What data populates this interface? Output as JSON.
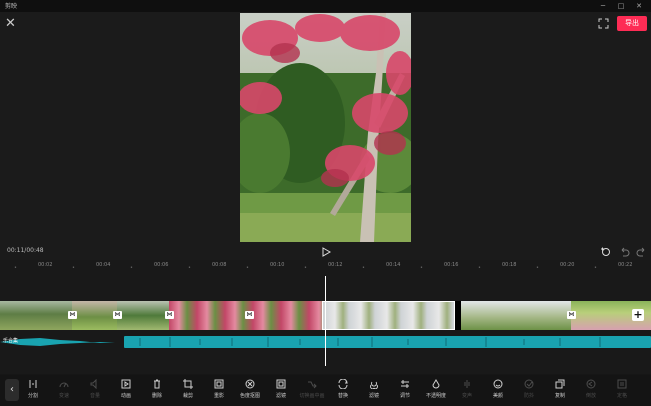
{
  "window": {
    "title": "剪映",
    "minimize": "─",
    "maximize": "□",
    "close": "✕"
  },
  "preview": {
    "close_icon": "✕",
    "export_label": "导出"
  },
  "player": {
    "timecode": "00:11/00:48"
  },
  "ruler": {
    "labels": [
      "00:02",
      "00:04",
      "00:06",
      "00:08",
      "00:10",
      "00:12",
      "00:14",
      "00:16",
      "00:18",
      "00:20",
      "00:22"
    ]
  },
  "timeline": {
    "audio_label": "乐合集",
    "add_icon": "+",
    "transition_icon": "⋈"
  },
  "toolbar": {
    "back_icon": "‹",
    "tools": [
      {
        "label": "分割",
        "icon": "split-icon",
        "enabled": true
      },
      {
        "label": "变速",
        "icon": "speed-icon",
        "enabled": false
      },
      {
        "label": "音量",
        "icon": "volume-icon",
        "enabled": false
      },
      {
        "label": "动画",
        "icon": "animation-icon",
        "enabled": true
      },
      {
        "label": "删除",
        "icon": "delete-icon",
        "enabled": true
      },
      {
        "label": "裁剪",
        "icon": "crop-icon",
        "enabled": true
      },
      {
        "label": "重影",
        "icon": "ghost-icon",
        "enabled": true
      },
      {
        "label": "色度抠图",
        "icon": "chroma-icon",
        "enabled": true
      },
      {
        "label": "滤镜",
        "icon": "filter-icon",
        "enabled": true
      },
      {
        "label": "切换画中画",
        "icon": "pip-icon",
        "enabled": false
      },
      {
        "label": "替换",
        "icon": "replace-icon",
        "enabled": true
      },
      {
        "label": "滤镜",
        "icon": "filter2-icon",
        "enabled": true
      },
      {
        "label": "调节",
        "icon": "adjust-icon",
        "enabled": true
      },
      {
        "label": "不透明度",
        "icon": "opacity-icon",
        "enabled": true
      },
      {
        "label": "变声",
        "icon": "voice-icon",
        "enabled": false
      },
      {
        "label": "美颜",
        "icon": "beauty-icon",
        "enabled": true
      },
      {
        "label": "防抖",
        "icon": "stabilize-icon",
        "enabled": false
      },
      {
        "label": "复制",
        "icon": "copy-icon",
        "enabled": true
      },
      {
        "label": "倒放",
        "icon": "reverse-icon",
        "enabled": false
      },
      {
        "label": "定格",
        "icon": "freeze-icon",
        "enabled": false
      }
    ]
  },
  "colors": {
    "accent": "#fe2c55",
    "audio": "#19a3b0",
    "background": "#161616"
  }
}
